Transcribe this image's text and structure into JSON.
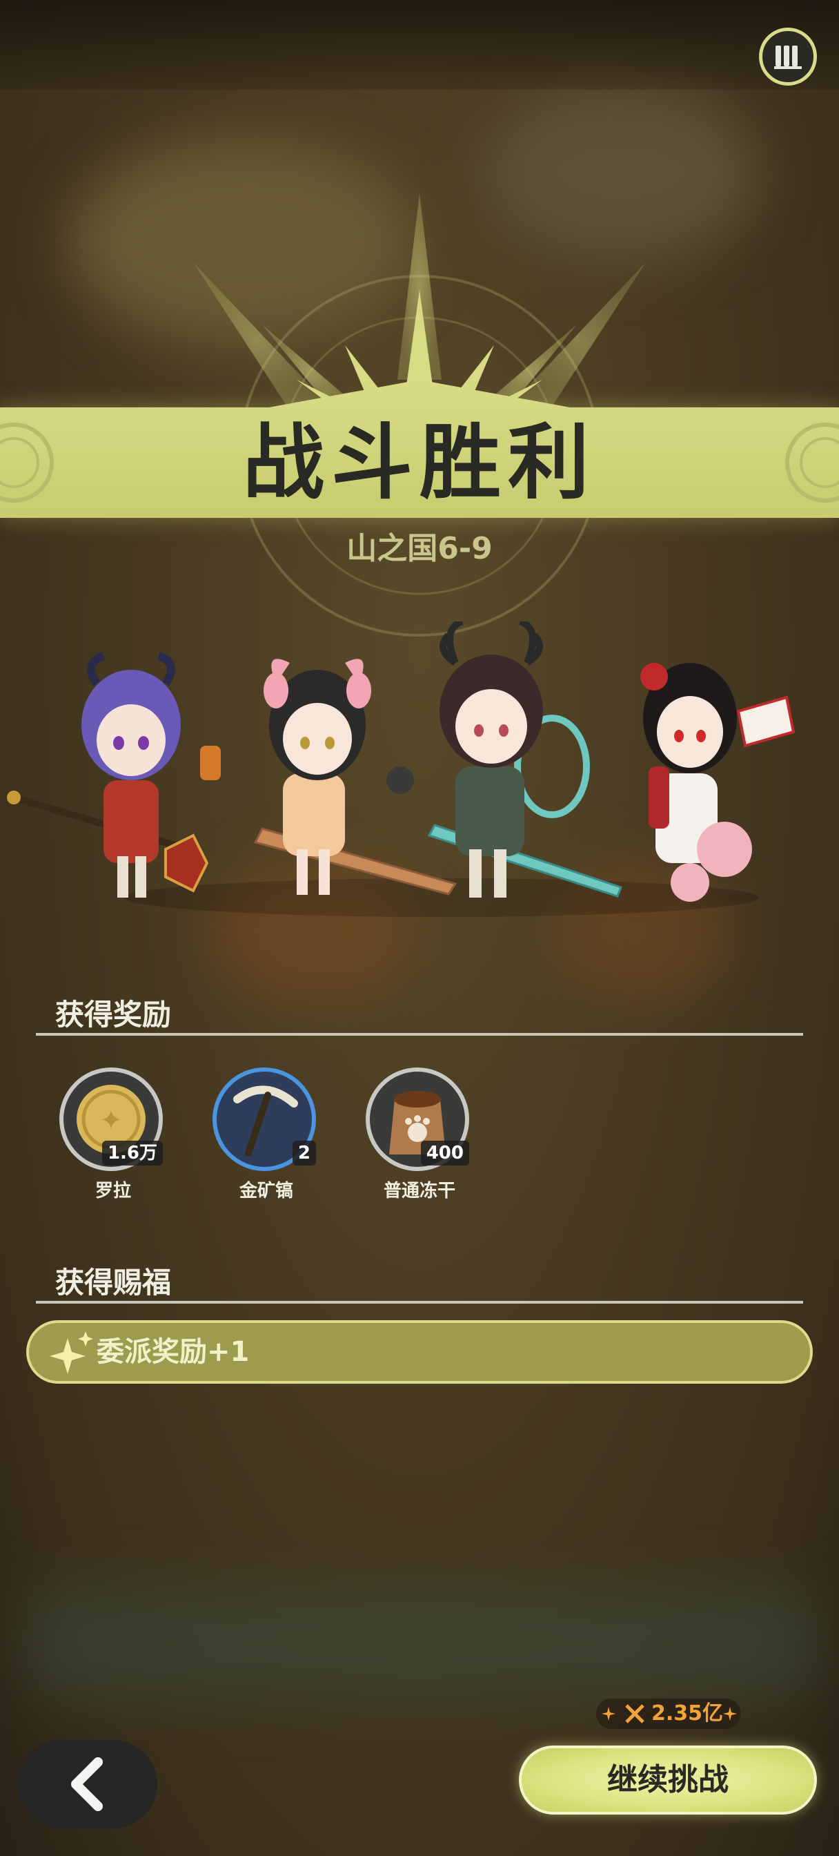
{
  "banner": {
    "title": "战斗胜利",
    "stage": "山之国6-9"
  },
  "rewards": {
    "section_title": "获得奖励",
    "items": [
      {
        "name": "罗拉",
        "count": "1.6万",
        "icon": "gold-coin-icon"
      },
      {
        "name": "金矿镐",
        "count": "2",
        "icon": "pickaxe-icon"
      },
      {
        "name": "普通冻干",
        "count": "400",
        "icon": "pet-food-bag-icon"
      }
    ]
  },
  "blessings": {
    "section_title": "获得赐福",
    "item": "委派奖励+1"
  },
  "footer": {
    "power": "2.35亿",
    "continue_label": "继续挑战"
  },
  "colors": {
    "banner": "#d4d882",
    "accent_gold": "#f4a23a",
    "button": "#dfe383"
  }
}
